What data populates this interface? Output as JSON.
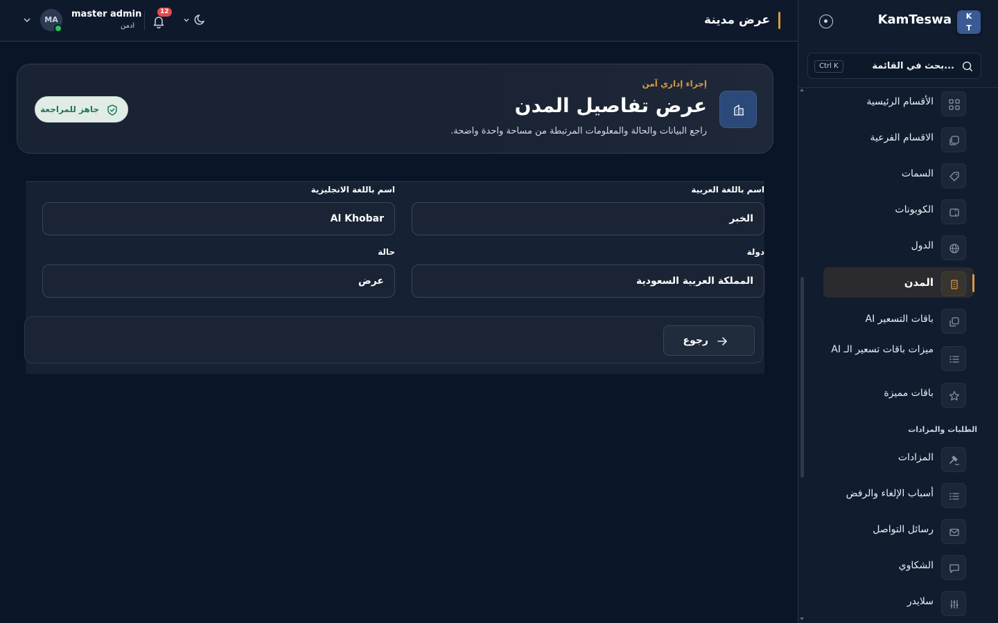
{
  "sidebar": {
    "logo_top": "K",
    "logo_bottom": "T",
    "brand": "KamTeswa",
    "search_placeholder": "بحث في القائمة...",
    "search_shortcut": "Ctrl K",
    "section_title": "الطلبات والمزادات",
    "items": [
      {
        "label": "الأقسام الرئيسية",
        "icon": "grid-icon"
      },
      {
        "label": "الاقسام الفرعية",
        "icon": "layers-icon"
      },
      {
        "label": "السمات",
        "icon": "tag-icon"
      },
      {
        "label": "الكوبونات",
        "icon": "ticket-icon"
      },
      {
        "label": "الدول",
        "icon": "globe-icon"
      },
      {
        "label": "المدن",
        "icon": "building-icon",
        "active": true
      },
      {
        "label": "باقات التسعير AI",
        "icon": "copy-icon"
      },
      {
        "label": "ميزات باقات تسعير الـ AI",
        "icon": "list-check-icon"
      },
      {
        "label": "باقات مميزة",
        "icon": "star-icon"
      },
      {
        "label": "المزادات",
        "icon": "gavel-icon"
      },
      {
        "label": "أسباب الإلغاء والرفض",
        "icon": "list-check-icon"
      },
      {
        "label": "رسائل التواصل",
        "icon": "mail-icon"
      },
      {
        "label": "الشكاوي",
        "icon": "message-icon"
      },
      {
        "label": "سلايدر",
        "icon": "sliders-icon"
      }
    ]
  },
  "topbar": {
    "page_title": "عرض مدينة",
    "user_name": "master admin",
    "user_role": "ادمن",
    "avatar_initials": "MA",
    "notifications_count": "12"
  },
  "hero": {
    "kicker": "إجراء إداري آمن",
    "title": "عرض تفاصيل المدن",
    "description": "راجع البيانات والحالة والمعلومات المرتبطة من مساحة واحدة واضحة.",
    "badge": "جاهز للمراجعة"
  },
  "form": {
    "name_ar_label": "اسم باللغة العربية",
    "name_ar_value": "الخبر",
    "name_en_label": "اسم باللغة الانجليزية",
    "name_en_value": "Al Khobar",
    "country_label": "دولة",
    "country_value": "المملكة العربية السعودية",
    "status_label": "حالة",
    "status_value": "عرض",
    "back_label": "رجوع"
  },
  "colors": {
    "accent": "#d99a3e",
    "background": "#0a1628",
    "success": "#22c55e",
    "badge_red": "#e34b4b"
  }
}
